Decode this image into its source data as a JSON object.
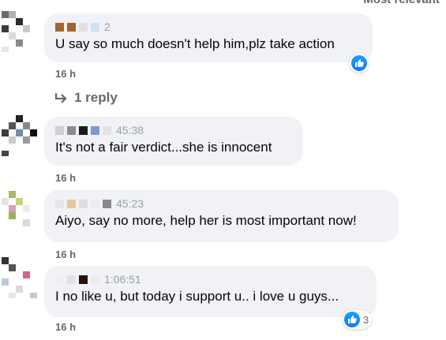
{
  "header": {
    "sort_label": "Most relevant"
  },
  "comments": [
    {
      "meta_value": "2",
      "text": "U say so much doesn't help him,plz take action",
      "time": "16 h",
      "reaction_count": "",
      "reply_label": "1 reply"
    },
    {
      "meta_value": "45:38",
      "text": "It's not a fair verdict...she is innocent",
      "time": "16 h"
    },
    {
      "meta_value": "45:23",
      "text": "Aiyo, say no more, help her is most important now!",
      "time": "16 h"
    },
    {
      "meta_value": "1:06:51",
      "text": "I no like u, but today i support u.. i love u guys...",
      "time": "16 h",
      "reaction_count": "3"
    }
  ],
  "colors": {
    "bubble": "#f0f2f5",
    "like": "#1877f2",
    "muted": "#65676b"
  },
  "icons": {
    "reply": "reply-arrow-icon",
    "like": "like-icon"
  }
}
